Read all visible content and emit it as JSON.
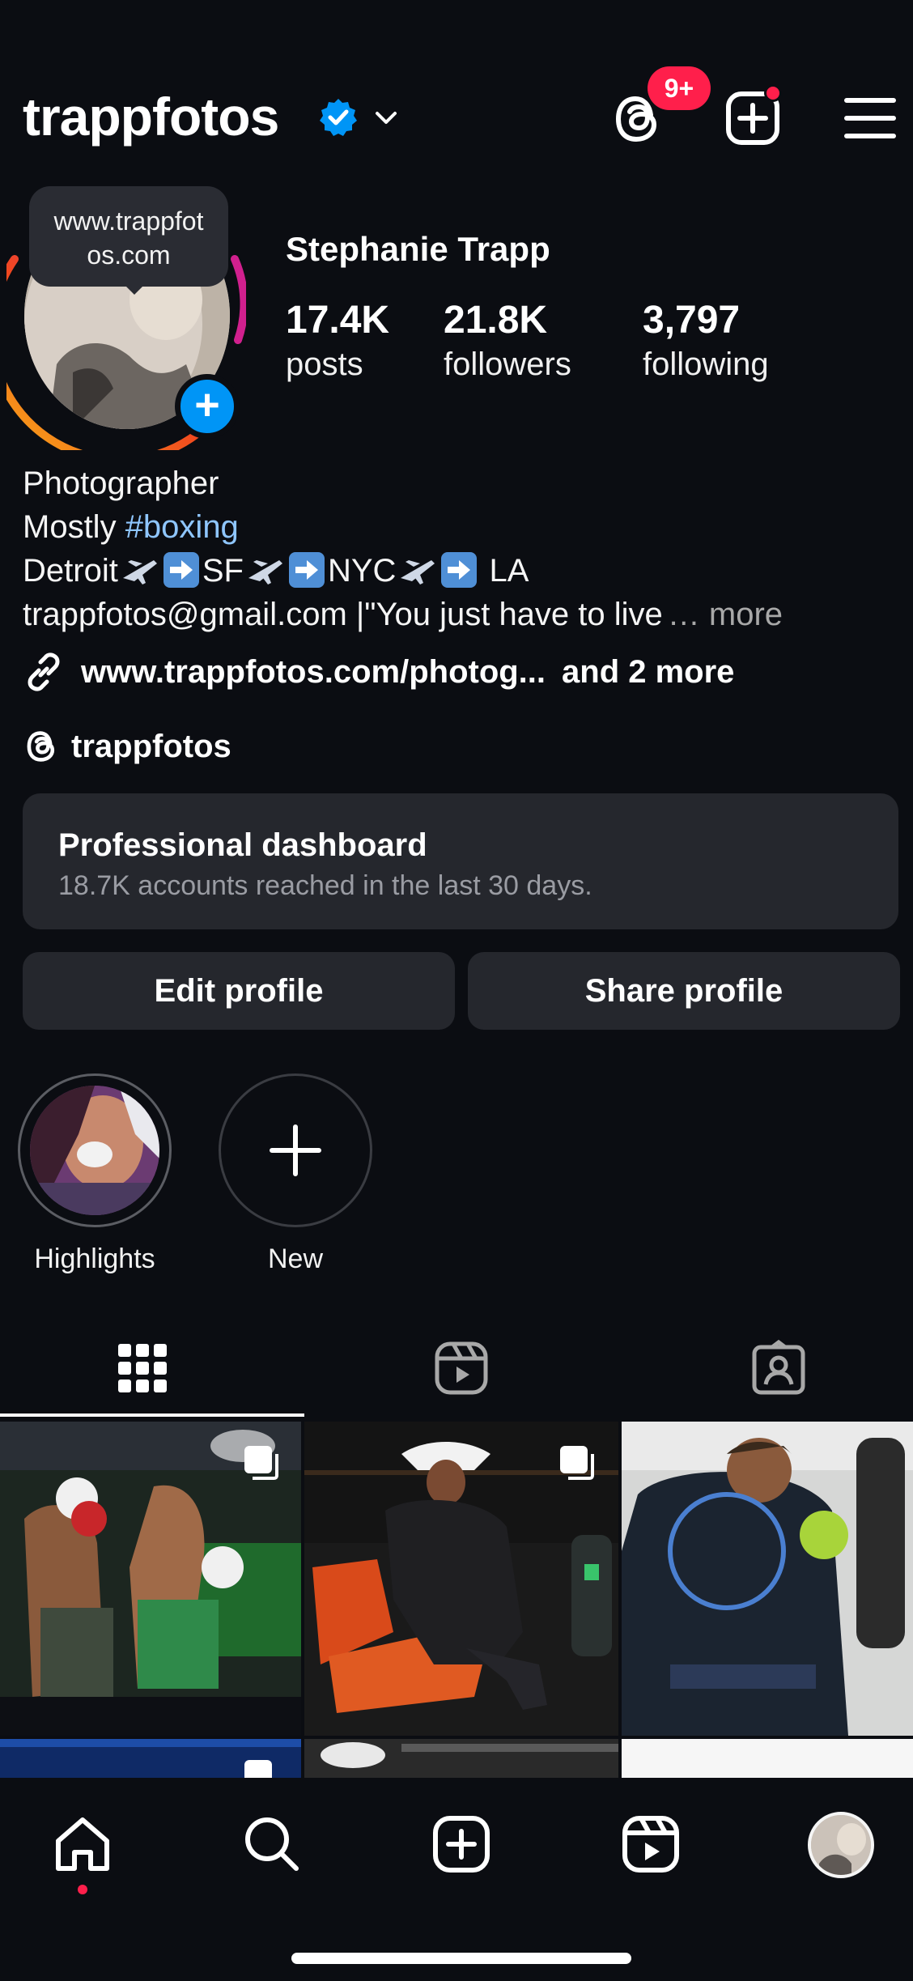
{
  "header": {
    "username": "trappfotos",
    "notification_badge": "9+"
  },
  "profile": {
    "tooltip": "www.trappfotos.com",
    "full_name": "Stephanie Trapp",
    "stats": {
      "posts_value": "17.4K",
      "posts_label": "posts",
      "followers_value": "21.8K",
      "followers_label": "followers",
      "following_value": "3,797",
      "following_label": "following"
    }
  },
  "bio": {
    "line1": "Photographer",
    "line2_prefix": "Mostly ",
    "line2_hashtag": "#boxing",
    "line3_city1": "Detroit",
    "line3_city2": "SF",
    "line3_city3": "NYC",
    "line3_city4": " LA",
    "line4": "trappfotos@gmail.com |\"You just have to live",
    "line4_more": "… more",
    "link_text": "www.trappfotos.com/photog...",
    "link_more": "and 2 more",
    "threads_handle": "trappfotos"
  },
  "dashboard": {
    "title": "Professional dashboard",
    "subtitle": "18.7K accounts reached in the last 30 days."
  },
  "buttons": {
    "edit": "Edit profile",
    "share": "Share profile"
  },
  "highlights": [
    {
      "label": "Highlights"
    },
    {
      "label": "New"
    }
  ],
  "colors": {
    "background": "#0b0d12",
    "accent_blue": "#0095f6",
    "badge_red": "#ff1f4b",
    "hashtag_blue": "#8fc6ff",
    "card": "#25272d"
  },
  "icons": {
    "header": [
      "threads-icon",
      "create-post-icon",
      "menu-icon"
    ],
    "tabs": [
      "grid-icon",
      "reels-icon",
      "tagged-icon"
    ],
    "nav": [
      "home-icon",
      "search-icon",
      "create-icon",
      "reels-icon",
      "profile-avatar"
    ]
  }
}
